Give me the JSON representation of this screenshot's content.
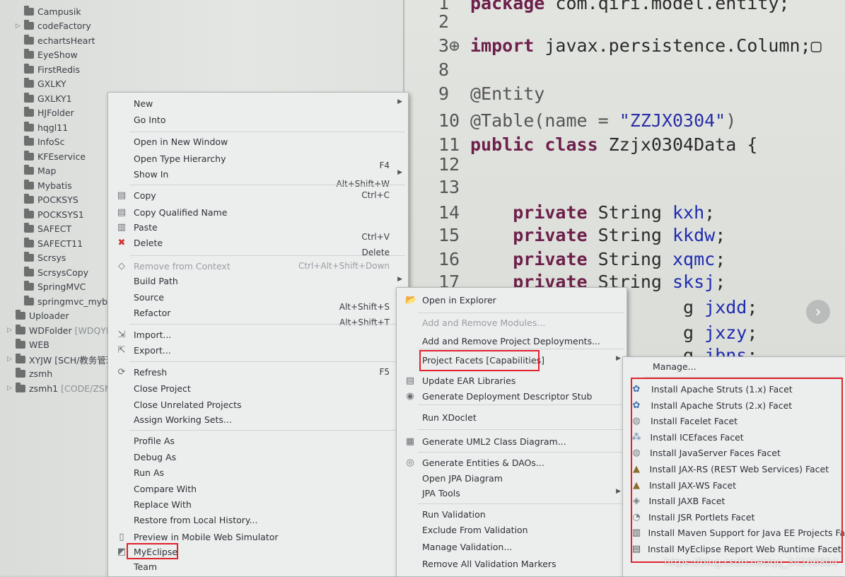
{
  "explorer": {
    "items": [
      {
        "label": "Campusik",
        "annot": ""
      },
      {
        "label": "codeFactory",
        "annot": "",
        "twisty": true
      },
      {
        "label": "echartsHeart",
        "annot": ""
      },
      {
        "label": "EyeShow",
        "annot": ""
      },
      {
        "label": "FirstRedis",
        "annot": ""
      },
      {
        "label": "GXLKY",
        "annot": ""
      },
      {
        "label": "GXLKY1",
        "annot": ""
      },
      {
        "label": "HJFolder",
        "annot": ""
      },
      {
        "label": "hqgl11",
        "annot": ""
      },
      {
        "label": "InfoSc",
        "annot": ""
      },
      {
        "label": "KFEservice",
        "annot": ""
      },
      {
        "label": "Map",
        "annot": ""
      },
      {
        "label": "Mybatis",
        "annot": ""
      },
      {
        "label": "POCKSYS",
        "annot": ""
      },
      {
        "label": "POCKSYS1",
        "annot": ""
      },
      {
        "label": "SAFECT",
        "annot": ""
      },
      {
        "label": "SAFECT11",
        "annot": ""
      },
      {
        "label": "Scrsys",
        "annot": ""
      },
      {
        "label": "ScrsysCopy",
        "annot": ""
      },
      {
        "label": "SpringMVC",
        "annot": ""
      },
      {
        "label": "springmvc_mybatis",
        "annot": ""
      },
      {
        "label": "Uploader",
        "annot": ""
      },
      {
        "label": "WDFolder",
        "annot": "[WDQYE",
        "twisty": true
      },
      {
        "label": "WEB",
        "annot": ""
      },
      {
        "label": "XYJW [SCH/教务管理",
        "annot": "",
        "twisty": true
      },
      {
        "label": "zsmh",
        "annot": ""
      },
      {
        "label": "zsmh1",
        "annot": "[CODE/ZSM",
        "twisty": true
      }
    ]
  },
  "editor": {
    "lines": [
      {
        "num": "1",
        "parts": [
          [
            "kw",
            "package "
          ],
          [
            "",
            "com.qiri.model.entity;"
          ]
        ]
      },
      {
        "num": "2",
        "parts": []
      },
      {
        "num": "3⊕",
        "parts": [
          [
            "kw",
            "import "
          ],
          [
            "",
            "javax.persistence.Column;▢"
          ]
        ]
      },
      {
        "num": "8",
        "parts": []
      },
      {
        "num": "9",
        "parts": [
          [
            "ann",
            "@Entity"
          ]
        ]
      },
      {
        "num": "10",
        "parts": [
          [
            "ann",
            "@Table(name = "
          ],
          [
            "str",
            "\"ZZJX0304\""
          ],
          [
            "ann",
            ")"
          ]
        ]
      },
      {
        "num": "11",
        "parts": [
          [
            "kw",
            "public class "
          ],
          [
            "",
            "Zzjx0304Data {"
          ]
        ]
      },
      {
        "num": "12",
        "parts": []
      },
      {
        "num": "13",
        "parts": []
      },
      {
        "num": "14",
        "parts": [
          [
            "",
            "    "
          ],
          [
            "kw",
            "private "
          ],
          [
            "",
            "String "
          ],
          [
            "fld",
            "kxh"
          ],
          [
            "",
            ";"
          ]
        ]
      },
      {
        "num": "15",
        "parts": [
          [
            "",
            "    "
          ],
          [
            "kw",
            "private "
          ],
          [
            "",
            "String "
          ],
          [
            "fld",
            "kkdw"
          ],
          [
            "",
            ";"
          ]
        ]
      },
      {
        "num": "16",
        "parts": [
          [
            "",
            "    "
          ],
          [
            "kw",
            "private "
          ],
          [
            "",
            "String "
          ],
          [
            "fld",
            "xqmc"
          ],
          [
            "",
            ";"
          ]
        ]
      },
      {
        "num": "17",
        "parts": [
          [
            "",
            "    "
          ],
          [
            "kw",
            "private "
          ],
          [
            "",
            "String "
          ],
          [
            "fld",
            "sksj"
          ],
          [
            "",
            ";"
          ]
        ]
      },
      {
        "num": "",
        "parts": [
          [
            "",
            "                    g "
          ],
          [
            "fld",
            "jxdd"
          ],
          [
            "",
            ";"
          ]
        ]
      },
      {
        "num": "",
        "parts": [
          [
            "",
            "                    g "
          ],
          [
            "fld",
            "jxzy"
          ],
          [
            "",
            ";"
          ]
        ]
      },
      {
        "num": "",
        "parts": [
          [
            "",
            "                    g "
          ],
          [
            "fld",
            "jbns"
          ],
          [
            "",
            ";"
          ]
        ]
      }
    ]
  },
  "context_menu": {
    "items": [
      {
        "label": "New",
        "acc": "",
        "arrow": true
      },
      {
        "label": "Go Into",
        "acc": "",
        "arrow": false
      },
      {
        "label": "Open in New Window",
        "acc": "",
        "arrow": false
      },
      {
        "label": "Open Type Hierarchy",
        "acc": "F4",
        "arrow": false
      },
      {
        "label": "Show In",
        "acc": "Alt+Shift+W",
        "arrow": true
      },
      {
        "label": "Copy",
        "acc": "Ctrl+C",
        "arrow": false
      },
      {
        "label": "Copy Qualified Name",
        "acc": "",
        "arrow": false
      },
      {
        "label": "Paste",
        "acc": "Ctrl+V",
        "arrow": false
      },
      {
        "label": "Delete",
        "acc": "Delete",
        "arrow": false
      },
      {
        "label": "Remove from Context",
        "acc": "Ctrl+Alt+Shift+Down",
        "arrow": false,
        "disabled": true
      },
      {
        "label": "Build Path",
        "acc": "",
        "arrow": true
      },
      {
        "label": "Source",
        "acc": "Alt+Shift+S",
        "arrow": true
      },
      {
        "label": "Refactor",
        "acc": "Alt+Shift+T",
        "arrow": true
      },
      {
        "label": "Import...",
        "acc": "",
        "arrow": false
      },
      {
        "label": "Export...",
        "acc": "",
        "arrow": false
      },
      {
        "label": "Refresh",
        "acc": "F5",
        "arrow": false
      },
      {
        "label": "Close Project",
        "acc": "",
        "arrow": false
      },
      {
        "label": "Close Unrelated Projects",
        "acc": "",
        "arrow": false
      },
      {
        "label": "Assign Working Sets...",
        "acc": "",
        "arrow": false
      },
      {
        "label": "Profile As",
        "acc": "",
        "arrow": true
      },
      {
        "label": "Debug As",
        "acc": "",
        "arrow": true
      },
      {
        "label": "Run As",
        "acc": "",
        "arrow": true
      },
      {
        "label": "Compare With",
        "acc": "",
        "arrow": true
      },
      {
        "label": "Replace With",
        "acc": "",
        "arrow": true
      },
      {
        "label": "Restore from Local History...",
        "acc": "",
        "arrow": false
      },
      {
        "label": "Preview in Mobile Web Simulator",
        "acc": "",
        "arrow": false
      },
      {
        "label": "MyEclipse",
        "acc": "",
        "arrow": true
      },
      {
        "label": "Team",
        "acc": "",
        "arrow": true
      }
    ]
  },
  "myeclipse_menu": {
    "items": [
      {
        "label": "Open in Explorer",
        "arrow": false
      },
      {
        "label": "Add and Remove Modules...",
        "arrow": false,
        "disabled": true
      },
      {
        "label": "Add and Remove Project Deployments...",
        "arrow": false
      },
      {
        "label": "Project Facets [Capabilities]",
        "arrow": true
      },
      {
        "label": "Update EAR Libraries",
        "arrow": false
      },
      {
        "label": "Generate Deployment Descriptor Stub",
        "arrow": false
      },
      {
        "label": "Run XDoclet",
        "arrow": false
      },
      {
        "label": "Generate UML2 Class Diagram...",
        "arrow": false
      },
      {
        "label": "Generate Entities & DAOs...",
        "arrow": false
      },
      {
        "label": "Open JPA Diagram",
        "arrow": false
      },
      {
        "label": "JPA Tools",
        "arrow": true
      },
      {
        "label": "Run Validation",
        "arrow": false
      },
      {
        "label": "Exclude From Validation",
        "arrow": false
      },
      {
        "label": "Manage Validation...",
        "arrow": false
      },
      {
        "label": "Remove All Validation Markers",
        "arrow": false
      }
    ]
  },
  "facets_menu": {
    "manage_label": "Manage...",
    "items": [
      "Install Apache Struts (1.x) Facet",
      "Install Apache Struts (2.x) Facet",
      "Install Facelet Facet",
      "Install ICEfaces Facet",
      "Install JavaServer Faces Facet",
      "Install JAX-RS (REST Web Services) Facet",
      "Install JAX-WS Facet",
      "Install JAXB Facet",
      "Install JSR Portlets Facet",
      "Install Maven Support for Java EE Projects Facet",
      "Install MyEclipse Report Web Runtime Facet"
    ]
  },
  "watermark": "https://blog.csdn.net/qq_34266804",
  "colors": {
    "highlight_box": "#e0222b"
  }
}
